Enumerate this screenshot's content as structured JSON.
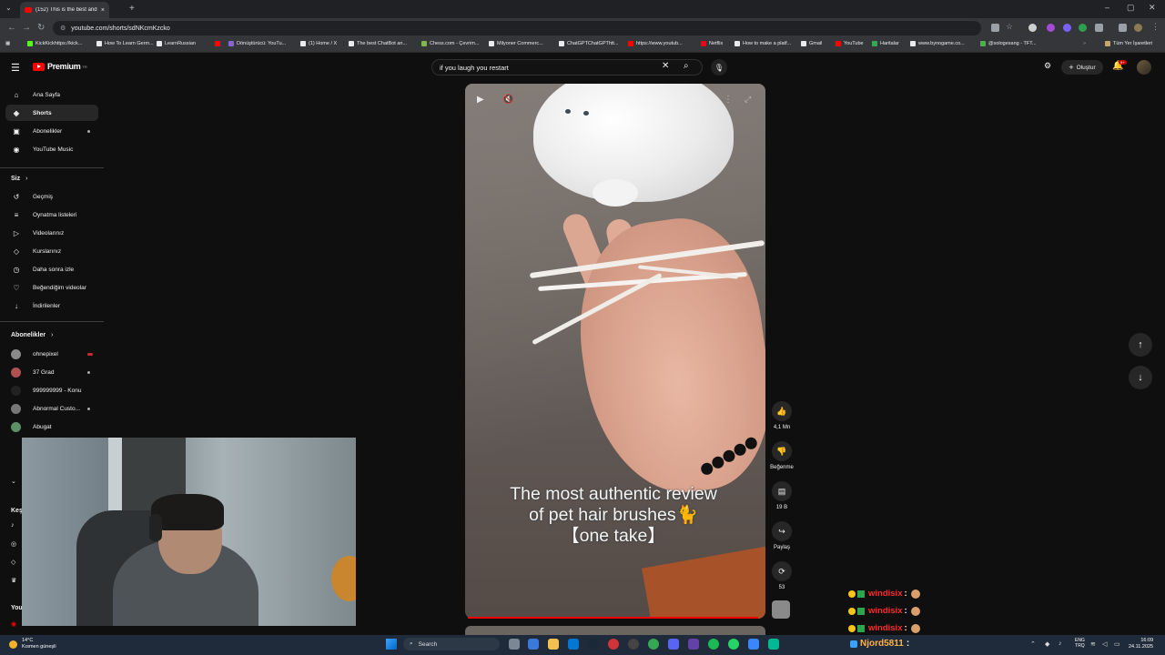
{
  "browser": {
    "tab_title": "(152) This is the best and fastes",
    "url": "youtube.com/shorts/sdNKcmKzcko",
    "bookmarks": [
      {
        "label": "KickKickhttps://kick...",
        "color": "#53fc18"
      },
      {
        "label": "How To Learn Germ...",
        "color": "#e8eaed"
      },
      {
        "label": "LearnRussian",
        "color": "#e8eaed"
      },
      {
        "label": "",
        "color": "#ff0000"
      },
      {
        "label": "Dönüştürücü: YouTu...",
        "color": "#8a63d2"
      },
      {
        "label": "(1) Home / X",
        "color": "#e8eaed"
      },
      {
        "label": "The best ChatBot an...",
        "color": "#e8eaed"
      },
      {
        "label": "Chess.com - Çevrim...",
        "color": "#81b64c"
      },
      {
        "label": "Milyoner Commerc...",
        "color": "#e8eaed"
      },
      {
        "label": "ChatGPTChatGPThtt...",
        "color": "#e8eaed"
      },
      {
        "label": "https://www.youtub...",
        "color": "#ff0000"
      },
      {
        "label": "Netflix",
        "color": "#e50914"
      },
      {
        "label": "How to make a platf...",
        "color": "#e8eaed"
      },
      {
        "label": "Gmail",
        "color": "#e8eaed"
      },
      {
        "label": "YouTube",
        "color": "#ff0000"
      },
      {
        "label": "Haritalar",
        "color": "#34a853"
      },
      {
        "label": "www.bynogame.co...",
        "color": "#e8eaed"
      },
      {
        "label": "@sologesang - TFT...",
        "color": "#4caf50"
      }
    ],
    "bookmarks_other": "Tüm Yer İşaretleri"
  },
  "youtube": {
    "logo_text": "Premium",
    "logo_region": "TR",
    "search_value": "if you laugh you restart",
    "create_label": "Oluştur",
    "notif_count": "9+",
    "sidebar": {
      "main": [
        {
          "label": "Ana Sayfa",
          "icon": "home-icon",
          "glyph": "⌂"
        },
        {
          "label": "Shorts",
          "icon": "shorts-icon",
          "glyph": "◈"
        },
        {
          "label": "Abonelikler",
          "icon": "subscriptions-icon",
          "glyph": "▣"
        },
        {
          "label": "YouTube Music",
          "icon": "music-icon",
          "glyph": "◉"
        }
      ],
      "you_header": "Siz",
      "you": [
        {
          "label": "Geçmiş",
          "icon": "history-icon",
          "glyph": "↺"
        },
        {
          "label": "Oynatma listeleri",
          "icon": "playlists-icon",
          "glyph": "≡"
        },
        {
          "label": "Videolarınız",
          "icon": "your-videos-icon",
          "glyph": "▷"
        },
        {
          "label": "Kurslarınız",
          "icon": "courses-icon",
          "glyph": "◇"
        },
        {
          "label": "Daha sonra izle",
          "icon": "watch-later-icon",
          "glyph": "◷"
        },
        {
          "label": "Beğendiğim videolar",
          "icon": "liked-icon",
          "glyph": "♡"
        },
        {
          "label": "İndirilenler",
          "icon": "downloads-icon",
          "glyph": "↓"
        }
      ],
      "subs_header": "Abonelikler",
      "subs": [
        {
          "label": "ohnepixel",
          "color": "#8a8a8a",
          "badge": "red"
        },
        {
          "label": "37 Grad",
          "color": "#b05050",
          "badge": "dot"
        },
        {
          "label": "999999999 - Konu",
          "color": "#222222",
          "badge": ""
        },
        {
          "label": "Abnormal Custo...",
          "color": "#777777",
          "badge": "dot"
        },
        {
          "label": "Abugat",
          "color": "#5d8f6a",
          "badge": ""
        }
      ],
      "explore_header_partial": "Keş",
      "you_partial": "You"
    },
    "short": {
      "caption_line1": "The most authentic review",
      "caption_line2": "of pet hair brushes🐈",
      "caption_line3": "【one take】",
      "progress_fraction": 0.99
    },
    "actions": {
      "likes": "4,1 Mn",
      "dislike_label": "Beğenme",
      "comments": "19 B",
      "share_label": "Paylaş",
      "remix_count": "53"
    }
  },
  "chat": [
    {
      "user": "windisix",
      "sep": ":"
    },
    {
      "user": "windisix",
      "sep": ":"
    },
    {
      "user": "windisix",
      "sep": ":"
    }
  ],
  "taskbar": {
    "temp": "14°C",
    "weather_desc": "Kısmen güneşli",
    "search_placeholder": "Search",
    "stream_user": "Njord5811",
    "stream_sep": ":",
    "lang1": "ENG",
    "lang2": "TRQ",
    "time": "16:09",
    "date": "24.11.2025"
  }
}
